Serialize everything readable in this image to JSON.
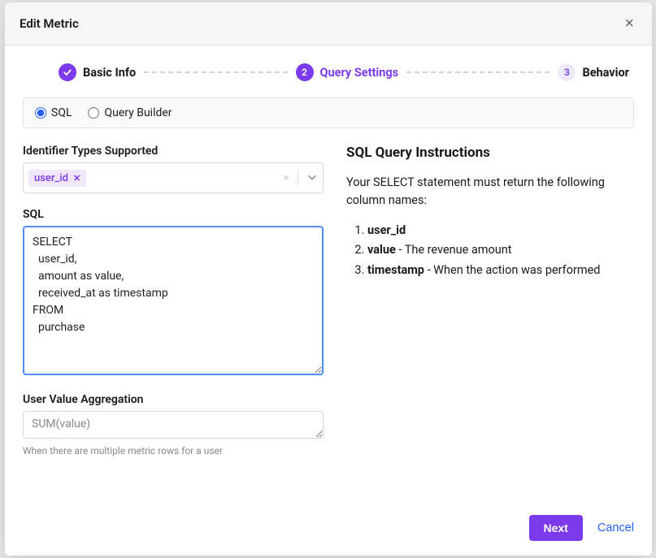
{
  "modal": {
    "title": "Edit Metric",
    "close_aria": "Close"
  },
  "steps": {
    "items": [
      {
        "num": "✓",
        "label": "Basic Info"
      },
      {
        "num": "2",
        "label": "Query Settings"
      },
      {
        "num": "3",
        "label": "Behavior"
      }
    ]
  },
  "mode": {
    "sql_label": "SQL",
    "builder_label": "Query Builder",
    "selected": "sql"
  },
  "identifier": {
    "label": "Identifier Types Supported",
    "tag": "user_id"
  },
  "sql": {
    "label": "SQL",
    "value": "SELECT\n  user_id,\n  amount as value,\n  received_at as timestamp\nFROM\n  purchase"
  },
  "aggregation": {
    "label": "User Value Aggregation",
    "value": "SUM(value)",
    "help": "When there are multiple metric rows for a user"
  },
  "instructions": {
    "title": "SQL Query Instructions",
    "lead": "Your SELECT statement must return the following column names:",
    "items": [
      {
        "col": "user_id",
        "desc": ""
      },
      {
        "col": "value",
        "desc": " - The revenue amount"
      },
      {
        "col": "timestamp",
        "desc": " - When the action was performed"
      }
    ]
  },
  "footer": {
    "next_label": "Next",
    "cancel_label": "Cancel"
  }
}
